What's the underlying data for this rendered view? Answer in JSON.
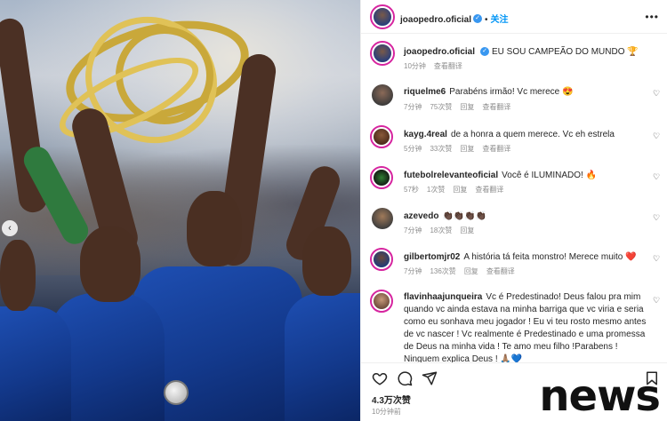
{
  "header": {
    "username": "joaopedro.oficial",
    "separator": "•",
    "follow_label": "关注",
    "more_label": "•••"
  },
  "caption": {
    "username": "joaopedro.oficial",
    "text": "EU SOU CAMPEÃO DO MUNDO 🏆",
    "time": "10分钟",
    "translate": "查看翻译"
  },
  "comments": [
    {
      "username": "riquelme6",
      "text": "Parabéns irmão! Vc merece 😍",
      "time": "7分钟",
      "likes": "75次赞",
      "reply": "回复",
      "translate": "查看翻译"
    },
    {
      "username": "kayg.4real",
      "text": "de a honra a quem merece. Vc eh estrela",
      "time": "5分钟",
      "likes": "33次赞",
      "reply": "回复",
      "translate": "查看翻译"
    },
    {
      "username": "futebolrelevanteoficial",
      "text": "Você é ILUMINADO! 🔥",
      "time": "57秒",
      "likes": "1次赞",
      "reply": "回复",
      "translate": "查看翻译"
    },
    {
      "username": "azevedo",
      "text": "👏🏿👏🏿👏🏿👏🏿",
      "time": "7分钟",
      "likes": "18次赞",
      "reply": "回复",
      "translate": ""
    },
    {
      "username": "gilbertomjr02",
      "text": "A história tá feita monstro! Merece muito ❤️",
      "time": "7分钟",
      "likes": "136次赞",
      "reply": "回复",
      "translate": "查看翻译"
    },
    {
      "username": "flavinhaajunqueira",
      "text": "Vc é Predestinado! Deus falou pra mim quando vc ainda estava na minha barriga que vc viria e seria como eu sonhava meu jogador ! Eu vi teu rosto mesmo antes de vc nascer ! Vc realmente é Predestinado e uma promessa de Deus na minha vida ! Te amo meu filho !Parabens ! Ninguem explica Deus ! 🙏🏽💙",
      "time": "",
      "likes": "",
      "reply": "",
      "translate": ""
    }
  ],
  "footer": {
    "likes": "4.3万次赞",
    "time": "10分钟前"
  },
  "watermark": "news",
  "icons": {
    "like": "heart-icon",
    "comment": "comment-icon",
    "share": "send-icon",
    "save": "bookmark-icon",
    "verified": "verified-badge-icon",
    "prev": "chevron-left-icon"
  },
  "colors": {
    "accent": "#0095f6",
    "verified": "#3897f0",
    "story_ring": "#d6249f",
    "jersey": "#1e4fb3",
    "trophy": "#c9a83a"
  }
}
